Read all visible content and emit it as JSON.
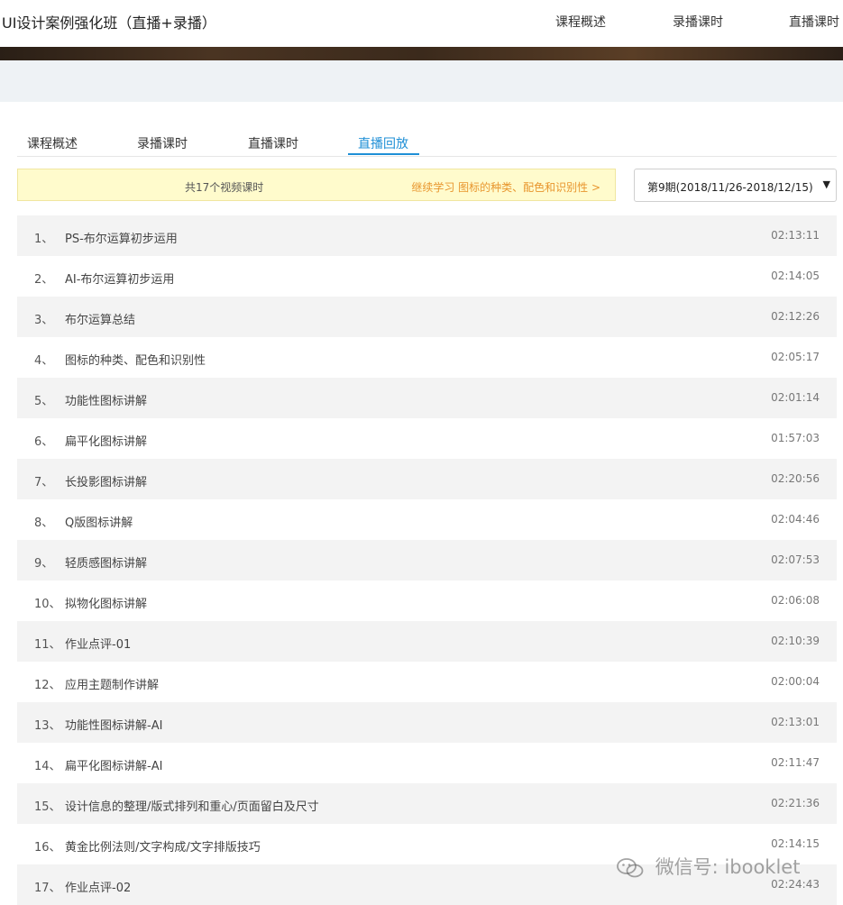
{
  "header": {
    "title": "UI设计案例强化班（直播+录播）",
    "nav": [
      "课程概述",
      "录播课时",
      "直播课时"
    ]
  },
  "tabs": {
    "items": [
      "课程概述",
      "录播课时",
      "直播课时",
      "直播回放"
    ],
    "active": "直播回放"
  },
  "notice": {
    "count": "共17个视频课时",
    "continue": "继续学习 图标的种类、配色和识别性 >"
  },
  "period": {
    "selected": "第9期(2018/11/26-2018/12/15)"
  },
  "lessons": [
    {
      "index": "1、",
      "title": "PS-布尔运算初步运用",
      "duration": "02:13:11"
    },
    {
      "index": "2、",
      "title": "AI-布尔运算初步运用",
      "duration": "02:14:05"
    },
    {
      "index": "3、",
      "title": "布尔运算总结",
      "duration": "02:12:26"
    },
    {
      "index": "4、",
      "title": "图标的种类、配色和识别性",
      "duration": "02:05:17"
    },
    {
      "index": "5、",
      "title": "功能性图标讲解",
      "duration": "02:01:14"
    },
    {
      "index": "6、",
      "title": "扁平化图标讲解",
      "duration": "01:57:03"
    },
    {
      "index": "7、",
      "title": "长投影图标讲解",
      "duration": "02:20:56"
    },
    {
      "index": "8、",
      "title": "Q版图标讲解",
      "duration": "02:04:46"
    },
    {
      "index": "9、",
      "title": "轻质感图标讲解",
      "duration": "02:07:53"
    },
    {
      "index": "10、",
      "title": "拟物化图标讲解",
      "duration": "02:06:08"
    },
    {
      "index": "11、",
      "title": "作业点评-01",
      "duration": "02:10:39"
    },
    {
      "index": "12、",
      "title": "应用主题制作讲解",
      "duration": "02:00:04"
    },
    {
      "index": "13、",
      "title": "功能性图标讲解-AI",
      "duration": "02:13:01"
    },
    {
      "index": "14、",
      "title": "扁平化图标讲解-AI",
      "duration": "02:11:47"
    },
    {
      "index": "15、",
      "title": "设计信息的整理/版式排列和重心/页面留白及尺寸",
      "duration": "02:21:36"
    },
    {
      "index": "16、",
      "title": "黄金比例法则/文字构成/文字排版技巧",
      "duration": "02:14:15"
    },
    {
      "index": "17、",
      "title": "作业点评-02",
      "duration": "02:24:43"
    }
  ],
  "watermark": {
    "text": "微信号: ibooklet"
  },
  "colors": {
    "accent": "#1f8fd6",
    "notice_bg": "#fffbcc",
    "continue_text": "#e8962e",
    "row_shade": "#f3f3f3"
  }
}
